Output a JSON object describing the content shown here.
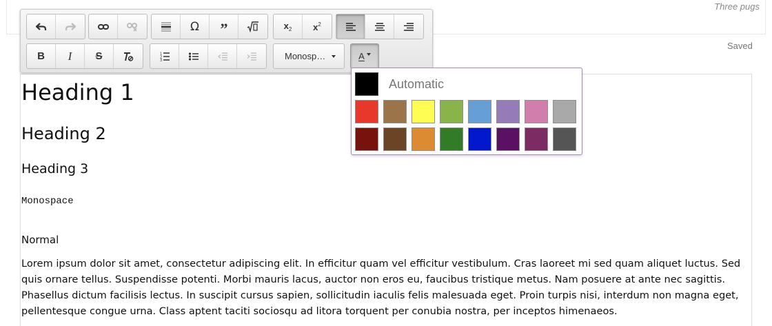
{
  "top_card": {
    "text": "Three pugs"
  },
  "status": {
    "saved": "Saved"
  },
  "toolbar": {
    "icons": {
      "undo": "undo-icon",
      "redo": "redo-icon",
      "link": "link-icon",
      "unlink": "unlink-icon",
      "hr": "horizontal-rule-icon",
      "special_char": "omega-icon",
      "blockquote": "quote-icon",
      "math": "square-root-icon",
      "subscript": "subscript-icon",
      "superscript": "superscript-icon",
      "align_left": "align-left-icon",
      "align_center": "align-center-icon",
      "align_right": "align-right-icon",
      "bold": "bold-icon",
      "italic": "italic-icon",
      "strike": "strikethrough-icon",
      "clear_format": "clear-format-icon",
      "ordered_list": "ordered-list-icon",
      "bullet_list": "bullet-list-icon",
      "outdent": "outdent-icon",
      "indent": "indent-icon"
    },
    "glyphs": {
      "special_char": "Ω",
      "blockquote": "”",
      "bold": "B",
      "italic": "I",
      "strike": "S",
      "sub_x": "x",
      "sub_n": "2",
      "sup_x": "x",
      "sup_n": "2"
    },
    "font_select": {
      "value": "Monosp…"
    },
    "text_color": {
      "label": "A"
    }
  },
  "palette": {
    "automatic_label": "Automatic",
    "automatic_color": "#000000",
    "swatches": [
      "#e8372b",
      "#9b744a",
      "#fdfd53",
      "#88b44a",
      "#669fd6",
      "#957cb8",
      "#d27ead",
      "#a9a9a9",
      "#77120d",
      "#6a4424",
      "#dc8b32",
      "#327b27",
      "#0118cc",
      "#5a1163",
      "#7d2b63",
      "#555555"
    ]
  },
  "editor": {
    "heading1": "Heading 1",
    "heading2": "Heading 2",
    "heading3": "Heading 3",
    "monospace": "Monospace",
    "normal": "Normal",
    "paragraph": "Lorem ipsum dolor sit amet, consectetur adipiscing elit. In efficitur quam vel efficitur vestibulum. Cras laoreet mi sed quam aliquet luctus. Sed quis ornare tellus. Suspendisse potenti. Morbi mauris lacus, auctor non eros eu, faucibus tristique metus. Nam posuere at ante nec sagittis. Phasellus dictum facilisis lectus. In suscipit cursus sapien, sollicitudin iaculis felis malesuada eget. Proin turpis nisi, interdum non magna eget, pellentesque congue urna. Class aptent taciti sociosqu ad litora torquent per conubia nostra, per inceptos himenaeos."
  }
}
